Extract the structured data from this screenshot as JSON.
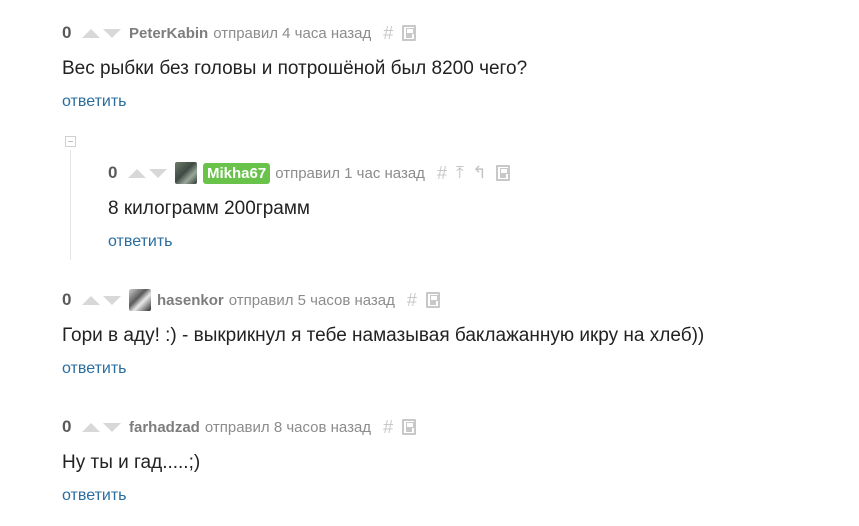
{
  "comments": [
    {
      "rating": "0",
      "author": "PeterKabin",
      "sent": "отправил 4 часа назад",
      "text": "Вес рыбки без головы и потрошёной был 8200 чего?",
      "reply": "ответить"
    },
    {
      "rating": "0",
      "author": "Mikha67",
      "sent": "отправил 1 час назад",
      "text": "8 килограмм 200грамм",
      "reply": "ответить",
      "author_highlight_color": "#69c34a"
    },
    {
      "rating": "0",
      "author": "hasenkor",
      "sent": "отправил 5 часов назад",
      "text": "Гори в аду! :) - выкрикнул я тебе намазывая баклажанную икру на хлеб))",
      "reply": "ответить"
    },
    {
      "rating": "0",
      "author": "farhadzad",
      "sent": "отправил 8 часов назад",
      "text": "Ну ты и гад.....;)",
      "reply": "ответить"
    }
  ],
  "icons": {
    "hash": "#",
    "up": "⤒",
    "parent": "↰"
  },
  "colors": {
    "link": "#2a6d9e",
    "author": "#7d7d7d",
    "text": "#222222",
    "vote_arrow": "#d8d8d8"
  }
}
